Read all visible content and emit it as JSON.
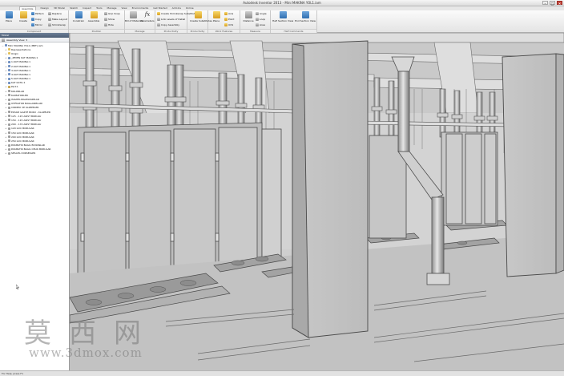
{
  "window": {
    "title": "Autodesk Inventor 2013 - Mini MAKINA YOL1.iam",
    "controls": [
      "–",
      "□",
      "✕"
    ]
  },
  "ribbon": {
    "tabs": [
      "Assemble",
      "Design",
      "3D Model",
      "Sketch",
      "Inspect",
      "Tools",
      "Manage",
      "View",
      "Environments",
      "Get Started",
      "Add-Ins",
      "Online"
    ],
    "groups": {
      "component": {
        "label": "Component",
        "place": "Place",
        "create": "Create",
        "pattern": "Pattern",
        "copy": "Copy",
        "mirror": "Mirror",
        "replace": "Replace",
        "make_layout": "Make Layout",
        "shrinkwrap": "Shrinkwrap"
      },
      "position": {
        "label": "Position",
        "constrain": "Constrain",
        "assemble": "Assemble",
        "free_move": "Free Move",
        "free_rotate": "Free Rotate",
        "grip_snap": "Grip Snap",
        "show": "Show",
        "hide": "Hide"
      },
      "manage": {
        "label": "Manage",
        "bill_of_materials": "Bill of Materials",
        "parameters": "Parameters"
      },
      "productivity": {
        "label": "Productivity",
        "create_shrinkwrap": "Create Shrinkwrap Substitute",
        "link_levels": "Link Levels of Detail",
        "assembly_copy": "Copy Assembly"
      },
      "substitutes": {
        "label": "Productivity",
        "create_substitutes": "Create Substitutes"
      },
      "work_features": {
        "label": "Work Features",
        "plane": "Plane",
        "axis": "Axis",
        "point": "Point",
        "ucs": "UCS"
      },
      "measure": {
        "label": "Measure",
        "distance": "Distance",
        "angle": "Angle",
        "loop": "Loop",
        "area": "Area"
      },
      "view_commands": {
        "label": "Half Commands",
        "half_section": "Half Section View",
        "end_section": "End Section View"
      }
    }
  },
  "browser": {
    "header": "Model",
    "toolbar_label": "Assembly View",
    "items": [
      {
        "label": "Mini MAKINA YOL1 (MRT).iam",
        "icon": "tico-asm",
        "exp": "−",
        "indent": 0
      },
      {
        "label": "Representations",
        "icon": "tico-folder",
        "exp": "+",
        "indent": 1
      },
      {
        "label": "Origin",
        "icon": "tico-folder",
        "exp": "+",
        "indent": 1
      },
      {
        "label": "_ZEMIN KAT MAKINA:1",
        "icon": "tico-asm",
        "exp": "+",
        "indent": 1
      },
      {
        "label": "1.KAT MAKINA:1",
        "icon": "tico-asm",
        "exp": "+",
        "indent": 1
      },
      {
        "label": "2.KAT MAKINA:1",
        "icon": "tico-asm",
        "exp": "+",
        "indent": 1
      },
      {
        "label": "3.KAT MAKINA:1",
        "icon": "tico-asm",
        "exp": "+",
        "indent": 1
      },
      {
        "label": "4.KAT MAKINA:1",
        "icon": "tico-asm",
        "exp": "+",
        "indent": 1
      },
      {
        "label": "5.KAT MAKINA:1",
        "icon": "tico-asm",
        "exp": "+",
        "indent": 1
      },
      {
        "label": "KAT KATIL:1",
        "icon": "tico-asm",
        "exp": "+",
        "indent": 1
      },
      {
        "label": "Part:1",
        "icon": "tico-part",
        "exp": "+",
        "indent": 1
      },
      {
        "label": "KOLONLAR",
        "icon": "tico-fold",
        "exp": "+",
        "indent": 1
      },
      {
        "label": "KLIMATORLER",
        "icon": "tico-fold",
        "exp": "+",
        "indent": 1
      },
      {
        "label": "ISIGHELIKGAMASIMLAR",
        "icon": "tico-fold",
        "exp": "+",
        "indent": 1
      },
      {
        "label": "UHFKATOR BAGLANMLARI",
        "icon": "tico-fold",
        "exp": "+",
        "indent": 1
      },
      {
        "label": "CIRDEKI VE KLIMPELER",
        "icon": "tico-fold",
        "exp": "+",
        "indent": 1
      },
      {
        "label": "EKSOZ GAZYE BORU - KLAPELER",
        "icon": "tico-fold",
        "exp": "+",
        "indent": 1
      },
      {
        "label": "125 - 115 AKIST BORULU",
        "icon": "tico-fold",
        "exp": "+",
        "indent": 1
      },
      {
        "label": "150 - 115 AKIST BORULU",
        "icon": "tico-fold",
        "exp": "+",
        "indent": 1
      },
      {
        "label": "200 - 174 AKIST BORULU",
        "icon": "tico-fold",
        "exp": "+",
        "indent": 1
      },
      {
        "label": "120 GVC BORULAR",
        "icon": "tico-fold",
        "exp": "+",
        "indent": 1
      },
      {
        "label": "150 GVC BORULAR",
        "icon": "tico-fold",
        "exp": "+",
        "indent": 1
      },
      {
        "label": "200 GVC BORULAR",
        "icon": "tico-fold",
        "exp": "+",
        "indent": 1
      },
      {
        "label": "250 GVC BORULAR",
        "icon": "tico-fold",
        "exp": "+",
        "indent": 1
      },
      {
        "label": "PASMATIK BAGIL ELMANLAR",
        "icon": "tico-fold",
        "exp": "+",
        "indent": 1
      },
      {
        "label": "PASMATIK BAGIL CELIK BORULAR",
        "icon": "tico-fold",
        "exp": "+",
        "indent": 1
      },
      {
        "label": "SESAHLI DIRSEKLER",
        "icon": "tico-fold",
        "exp": "+",
        "indent": 1
      }
    ]
  },
  "status": {
    "text": "For Help, press F1"
  },
  "watermark": {
    "chars": [
      "莫",
      "西",
      "网"
    ],
    "url": "www.3dmox.com"
  }
}
